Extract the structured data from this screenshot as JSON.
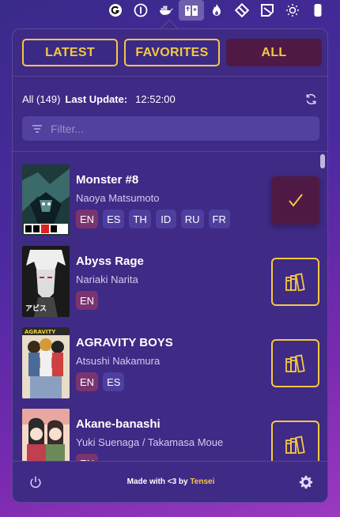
{
  "menubar": {
    "icons": [
      "app-g-icon",
      "one-password-icon",
      "docker-icon",
      "manga-reader-icon",
      "flame-icon",
      "diamond-tool-icon",
      "note-icon",
      "brightness-icon",
      "phone-icon"
    ]
  },
  "tabs": [
    {
      "label": "LATEST",
      "active": false
    },
    {
      "label": "FAVORITES",
      "active": false
    },
    {
      "label": "ALL",
      "active": true
    }
  ],
  "info": {
    "count": "All (149)",
    "last_update_label": "Last Update:",
    "last_update_time": "12:52:00"
  },
  "filter": {
    "placeholder": "Filter..."
  },
  "manga": [
    {
      "title": "Monster #8",
      "author": "Naoya Matsumoto",
      "langs": [
        "EN",
        "ES",
        "TH",
        "ID",
        "RU",
        "FR"
      ],
      "active_lang": "EN",
      "favorited": true
    },
    {
      "title": "Abyss Rage",
      "author": "Nariaki Narita",
      "langs": [
        "EN"
      ],
      "active_lang": "EN",
      "favorited": false
    },
    {
      "title": "AGRAVITY BOYS",
      "author": "Atsushi Nakamura",
      "langs": [
        "EN",
        "ES"
      ],
      "active_lang": "EN",
      "favorited": false
    },
    {
      "title": "Akane-banashi",
      "author": "Yuki Suenaga / Takamasa Moue",
      "langs": [
        "EN"
      ],
      "active_lang": "EN",
      "favorited": false
    }
  ],
  "footer": {
    "credit_prefix": "Made with <3 by ",
    "credit_author": "Tensei"
  },
  "colors": {
    "accent": "#f5c842",
    "active_bg": "#4e1a45",
    "panel_bg": "#3f2a86"
  }
}
